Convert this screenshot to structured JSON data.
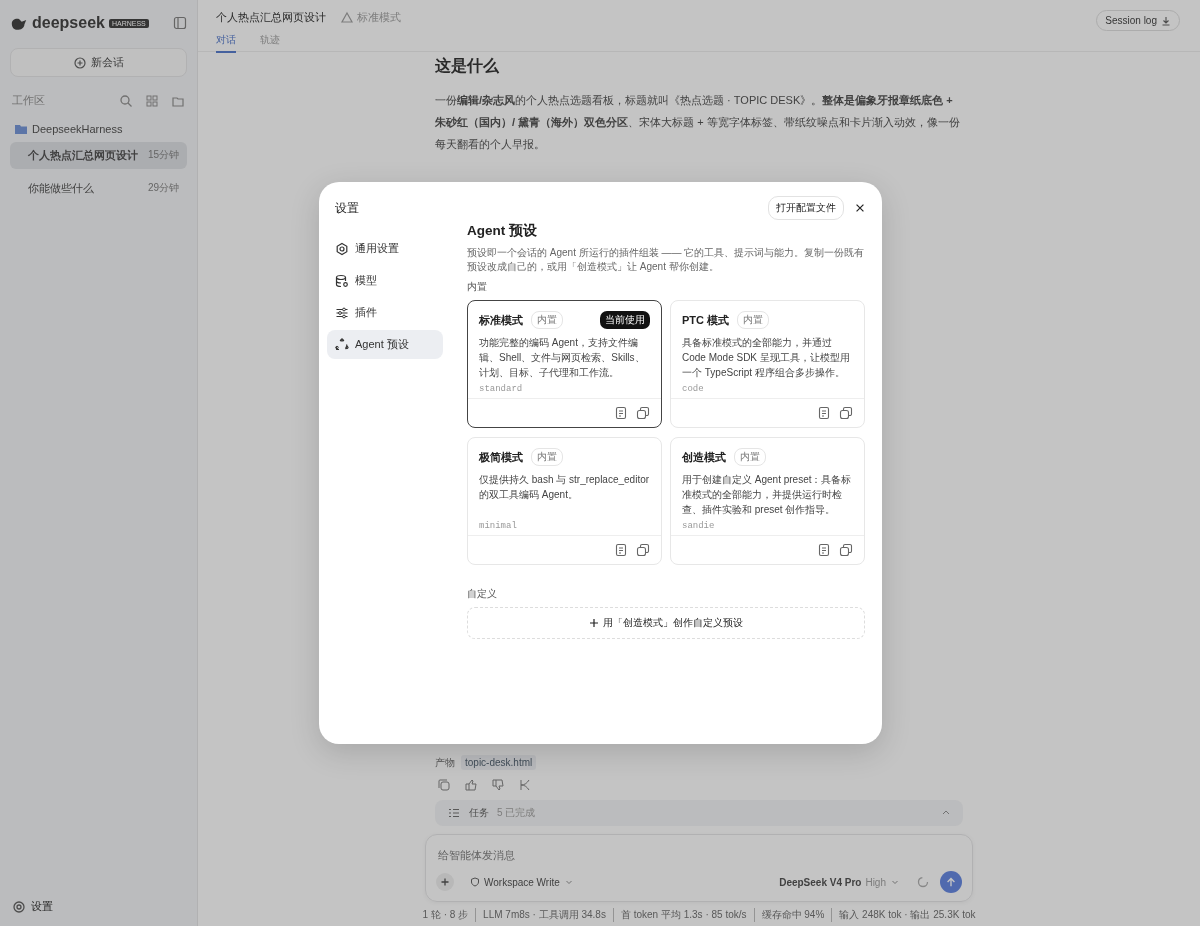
{
  "sidebar": {
    "brand": "deepseek",
    "brand_badge": "HARNESS",
    "new_chat": "新会话",
    "workspace_label": "工作区",
    "project": "DeepseekHarness",
    "sessions": [
      {
        "title": "个人热点汇总网页设计",
        "time": "15分钟",
        "selected": true
      },
      {
        "title": "你能做些什么",
        "time": "29分钟",
        "selected": false
      }
    ],
    "settings": "设置"
  },
  "header": {
    "title": "个人热点汇总网页设计",
    "mode": "标准模式",
    "session_log": "Session log",
    "tabs": [
      {
        "label": "对话",
        "selected": true
      },
      {
        "label": "轨迹",
        "selected": false
      }
    ]
  },
  "content": {
    "heading": "这是什么",
    "paragraph": "一份**编辑/杂志风**的个人热点选题看板，标题就叫《热点选题 · TOPIC DESK》。**整体是偏象牙报章纸底色 + 朱砂红（国内）/ 黛青（海外）双色分区**、宋体大标题 + 等宽字体标签、带纸纹噪点和卡片渐入动效，像一份每天翻看的个人早报。",
    "artifact_label": "产物",
    "artifact_file": "topic-desk.html",
    "tasks_label": "任务",
    "tasks_status": "5 已完成"
  },
  "composer": {
    "placeholder": "给智能体发消息",
    "permission": "Workspace Write",
    "model": "DeepSeek V4 Pro",
    "effort": "High"
  },
  "status_bar": [
    "1 轮 · 8 步",
    "LLM 7m8s · 工具调用 34.8s",
    "首 token 平均 1.3s · 85 tok/s",
    "缓存命中 94%",
    "输入 248K tok · 输出 25.3K tok"
  ],
  "dialog": {
    "title": "设置",
    "open_config": "打开配置文件",
    "nav": [
      {
        "label": "通用设置",
        "selected": false
      },
      {
        "label": "模型",
        "selected": false
      },
      {
        "label": "插件",
        "selected": false
      },
      {
        "label": "Agent 预设",
        "selected": true
      }
    ],
    "heading": "Agent 预设",
    "description": "预设即一个会话的 Agent 所运行的插件组装 —— 它的工具、提示词与能力。复制一份既有预设改成自己的，或用「创造模式」让 Agent 帮你创建。",
    "builtin_label": "内置",
    "presets": [
      {
        "name": "标准模式",
        "tag": "内置",
        "current_label": "当前使用",
        "selected": true,
        "description": "功能完整的编码 Agent，支持文件编辑、Shell、文件与网页检索、Skills、计划、目标、子代理和工作流。",
        "slug": "standard"
      },
      {
        "name": "PTC 模式",
        "tag": "内置",
        "selected": false,
        "description": "具备标准模式的全部能力，并通过 Code Mode SDK 呈现工具，让模型用一个 TypeScript 程序组合多步操作。",
        "slug": "code"
      },
      {
        "name": "极简模式",
        "tag": "内置",
        "selected": false,
        "description": "仅提供持久 bash 与 str_replace_editor 的双工具编码 Agent。",
        "slug": "minimal"
      },
      {
        "name": "创造模式",
        "tag": "内置",
        "selected": false,
        "description": "用于创建自定义 Agent preset：具备标准模式的全部能力，并提供运行时检查、插件实验和 preset 创作指导。",
        "slug": "sandie"
      }
    ],
    "custom_label": "自定义",
    "create_button": "用「创造模式」创作自定义预设"
  }
}
